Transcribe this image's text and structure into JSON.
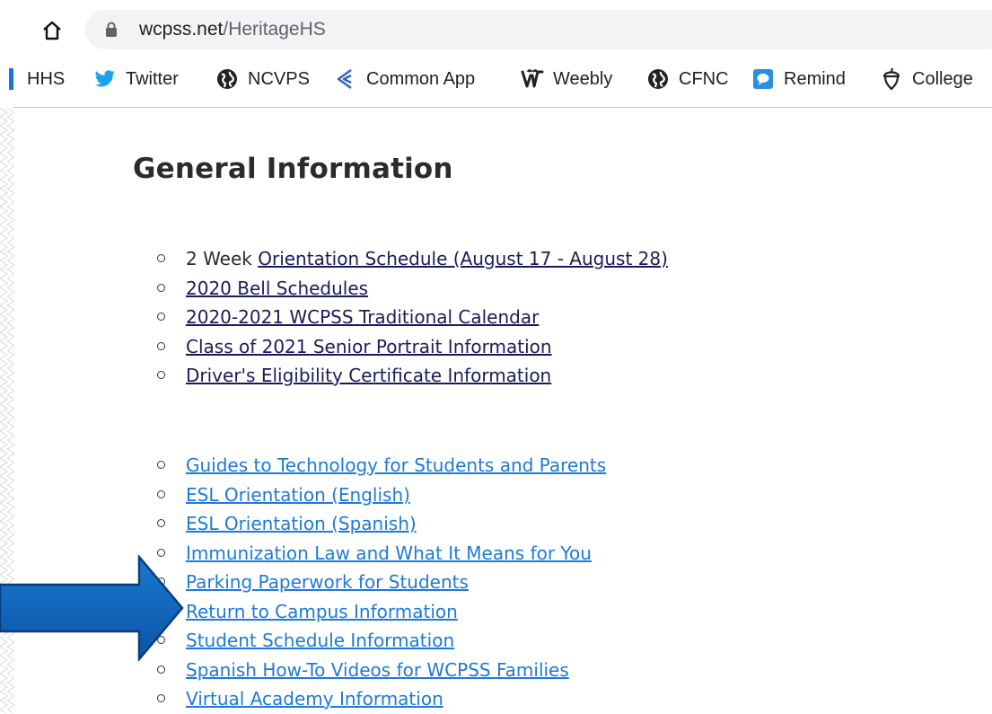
{
  "browser": {
    "url_host": "wcpss.net",
    "url_path": "/HeritageHS"
  },
  "bookmarks": [
    {
      "label": "HHS",
      "icon": "hhs-mark-icon"
    },
    {
      "label": "Twitter",
      "icon": "twitter-icon"
    },
    {
      "label": "NCVPS",
      "icon": "globe-icon"
    },
    {
      "label": "Common App",
      "icon": "common-app-icon"
    },
    {
      "label": "Weebly",
      "icon": "weebly-icon"
    },
    {
      "label": "CFNC",
      "icon": "globe-icon"
    },
    {
      "label": "Remind",
      "icon": "remind-icon"
    },
    {
      "label": "College",
      "icon": "acorn-icon"
    }
  ],
  "page": {
    "title": "General Information",
    "list1": [
      {
        "prefix": "2 Week ",
        "link": "Orientation Schedule (August 17 - August 28) "
      },
      {
        "prefix": "",
        "link": "2020 Bell Schedules"
      },
      {
        "prefix": "",
        "link": "2020-2021 WCPSS Traditional Calendar"
      },
      {
        "prefix": "",
        "link": "Class of 2021 Senior Portrait Information"
      },
      {
        "prefix": "",
        "link": "Driver's Eligibility Certificate Information"
      }
    ],
    "list2": [
      "Guides to Technology for Students and Parents",
      "ESL Orientation (English)",
      "ESL Orientation (Spanish)",
      "Immunization Law and What It Means for You",
      "Parking Paperwork for Students",
      "Return to Campus Information",
      "Student Schedule Information",
      "Spanish How-To Videos for WCPSS Families",
      "Virtual Academy Information"
    ]
  },
  "colors": {
    "arrow_fill": "#0f63b8",
    "arrow_stroke": "#0a3e78",
    "link_visited": "#1c1b5a",
    "link": "#1d7ad8"
  }
}
